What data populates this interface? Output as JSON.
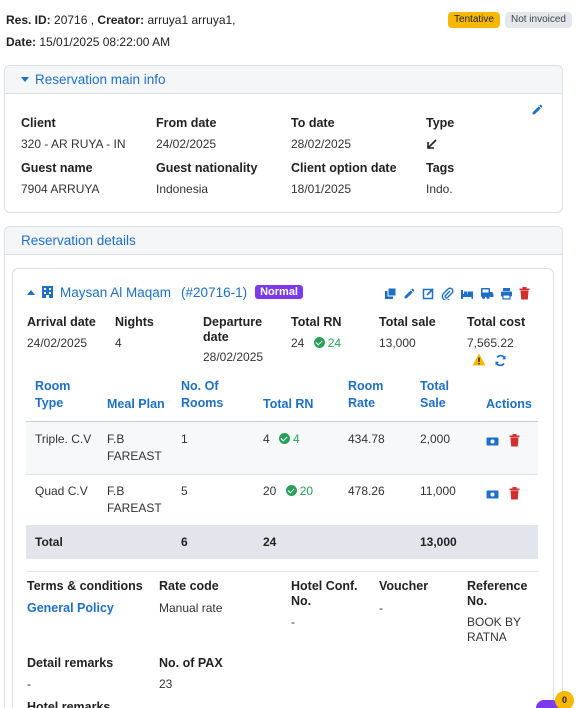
{
  "header": {
    "res_id_label": "Res. ID:",
    "res_id": "20716",
    "creator_label": "Creator:",
    "creator": "arruya1 arruya1,",
    "date_label": "Date:",
    "date": "15/01/2025 08:22:00 AM",
    "badge_tentative": "Tentative",
    "badge_invoice": "Not invoiced"
  },
  "main_info": {
    "title": "Reservation main info",
    "client_label": "Client",
    "client": "320 - AR RUYA - IN",
    "from_label": "From date",
    "from": "24/02/2025",
    "to_label": "To date",
    "to": "28/02/2025",
    "type_label": "Type",
    "guest_label": "Guest name",
    "guest": "7904 ARRUYA",
    "nationality_label": "Guest nationality",
    "nationality": "Indonesia",
    "option_label": "Client option date",
    "option": "18/01/2025",
    "tags_label": "Tags",
    "tags": "Indo."
  },
  "details": {
    "title": "Reservation details",
    "hotel_name": "Maysan Al Maqam",
    "hotel_ref": "(#20716-1)",
    "hotel_badge": "Normal",
    "arrival_label": "Arrival date",
    "arrival": "24/02/2025",
    "nights_label": "Nights",
    "nights": "4",
    "departure_label": "Departure date",
    "departure": "28/02/2025",
    "total_rn_label": "Total RN",
    "total_rn": "24",
    "total_rn_ok": "24",
    "total_sale_label": "Total sale",
    "total_sale": "13,000",
    "total_cost_label": "Total cost",
    "total_cost": "7,565.22"
  },
  "rooms_table": {
    "headers": [
      "Room Type",
      "Meal Plan",
      "No. Of Rooms",
      "Total RN",
      "Room Rate",
      "Total Sale",
      "Actions"
    ],
    "rows": [
      {
        "room_type": "Triple. C.V",
        "meal_plan": "F.B FAREAST",
        "rooms": "1",
        "rn": "4",
        "rn_ok": "4",
        "rate": "434.78",
        "sale": "2,000"
      },
      {
        "room_type": "Quad C.V",
        "meal_plan": "F.B FAREAST",
        "rooms": "5",
        "rn": "20",
        "rn_ok": "20",
        "rate": "478.26",
        "sale": "11,000"
      }
    ],
    "total": {
      "label": "Total",
      "rooms": "6",
      "rn": "24",
      "sale": "13,000"
    }
  },
  "extra": {
    "terms_label": "Terms & conditions",
    "terms": "General Policy",
    "rate_code_label": "Rate code",
    "rate_code": "Manual rate",
    "hotel_conf_label": "Hotel Conf. No.",
    "hotel_conf": "-",
    "voucher_label": "Voucher",
    "voucher": "-",
    "reference_label": "Reference No.",
    "reference": "BOOK BY RATNA",
    "detail_remarks_label": "Detail remarks",
    "detail_remarks": "-",
    "pax_label": "No. of PAX",
    "pax": "23",
    "hotel_remarks_label": "Hotel remarks"
  },
  "chat": {
    "count": "0"
  },
  "colors": {
    "accent": "#1e6fc8",
    "tentative": "#f6b800",
    "normal": "#7c3aed",
    "ok": "#27a157",
    "delete": "#d32f2f"
  }
}
